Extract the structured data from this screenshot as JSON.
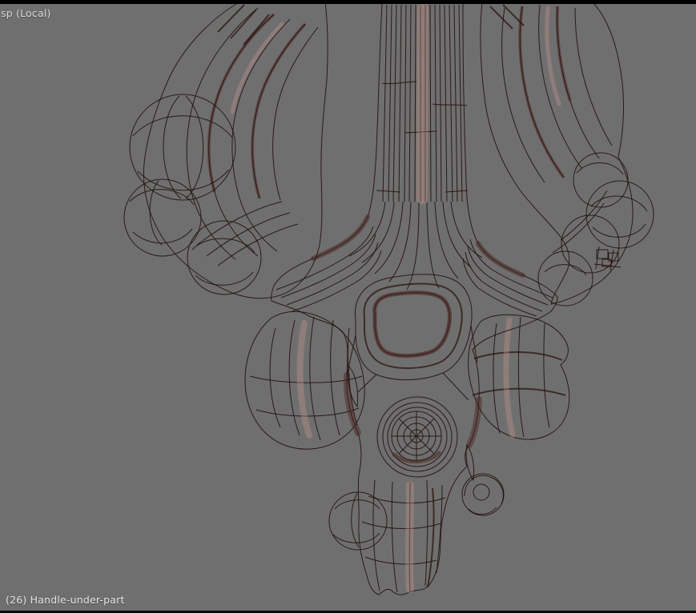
{
  "viewport": {
    "view_label": "sp (Local)",
    "object_label": "(26) Handle-under-part",
    "object_index": "26",
    "object_name": "Handle-under-part",
    "background_color": "#6f6f6f",
    "top_bar_color": "#000000",
    "bottom_bar_color": "#0a0a0a",
    "label_color": "#d8d8d8"
  },
  "mesh": {
    "name": "Handle-under-part",
    "display_mode": "solid-with-wireframe",
    "surface_base_color": "#a06962",
    "surface_highlight_color": "#c6948c",
    "surface_shadow_color": "#5e322d",
    "wireframe_color": "#231110"
  }
}
